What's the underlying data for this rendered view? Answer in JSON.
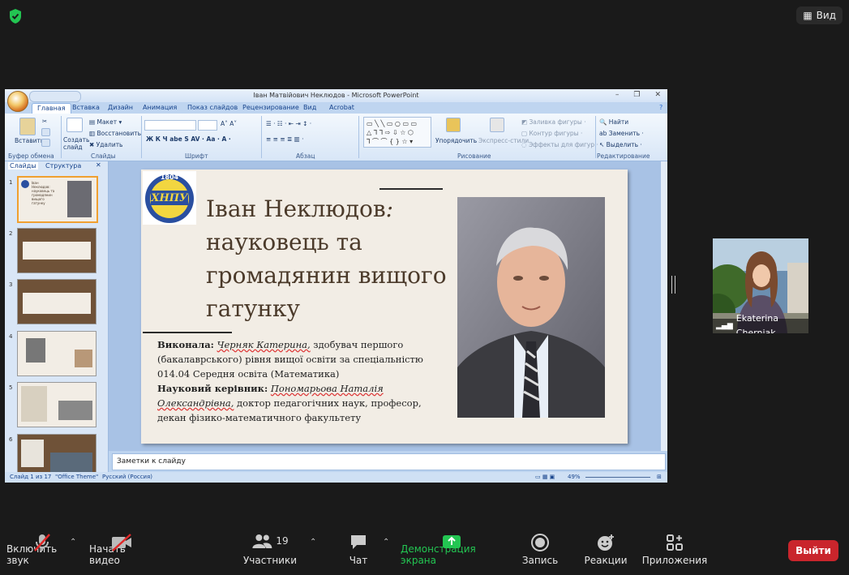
{
  "top": {
    "view_label": "Вид"
  },
  "ppt": {
    "window_title": "Іван Матвійович Неклюдов - Microsoft PowerPoint",
    "tabs": [
      "Главная",
      "Вставка",
      "Дизайн",
      "Анимация",
      "Показ слайдов",
      "Рецензирование",
      "Вид",
      "Acrobat"
    ],
    "ribbon": {
      "paste": "Вставить",
      "create_slide": "Создать слайд",
      "layout": "Макет",
      "reset": "Восстановить",
      "delete": "Удалить",
      "arrange": "Упорядочить",
      "quick_styles": "Экспресс-стили",
      "shape_fill": "Заливка фигуры",
      "shape_outline": "Контур фигуры",
      "shape_effects": "Эффекты для фигур",
      "find": "Найти",
      "replace": "Заменить",
      "select": "Выделить",
      "groups": [
        "Буфер обмена",
        "Слайды",
        "Шрифт",
        "Абзац",
        "Рисование",
        "Редактирование"
      ]
    },
    "side_tabs": [
      "Слайды",
      "Структура"
    ],
    "thumbnail_numbers": [
      "1",
      "2",
      "3",
      "4",
      "5",
      "6"
    ],
    "notes_placeholder": "Заметки к слайду",
    "status": {
      "slide": "Слайд 1 из 17",
      "theme": "\"Office Theme\"",
      "lang": "Русский (Россия)",
      "zoom": "49%"
    }
  },
  "slide": {
    "logo_year": "1804",
    "logo_text": "ХНПУ",
    "title_part1": "Іван Неклюдов",
    "title_colon": ":",
    "title_rest": "науковець та громадянин вищого гатунку",
    "lines": {
      "by_label": "Виконала:",
      "by_name": "Черняк Катерина,",
      "by_rest": " здобувач першого (бакалаврського) рівня вищої освіти за спеціальністю 014.04 Середня освіта (Математика)",
      "sup_label": "Науковий керівник:",
      "sup_name": "Пономарьова Наталія Олександрівна,",
      "sup_rest": " доктор педагогічних наук, професор, декан фізико-математичного факультету"
    }
  },
  "participant": {
    "name": "Ekaterina Cherniak"
  },
  "toolbar": {
    "mute": "Включить звук",
    "video": "Начать видео",
    "participants": "Участники",
    "participants_count": "19",
    "chat": "Чат",
    "share": "Демонстрация экрана",
    "record": "Запись",
    "reactions": "Реакции",
    "apps": "Приложения",
    "leave": "Выйти"
  },
  "colors": {
    "share_green": "#23c552",
    "leave_red": "#c9252c"
  }
}
